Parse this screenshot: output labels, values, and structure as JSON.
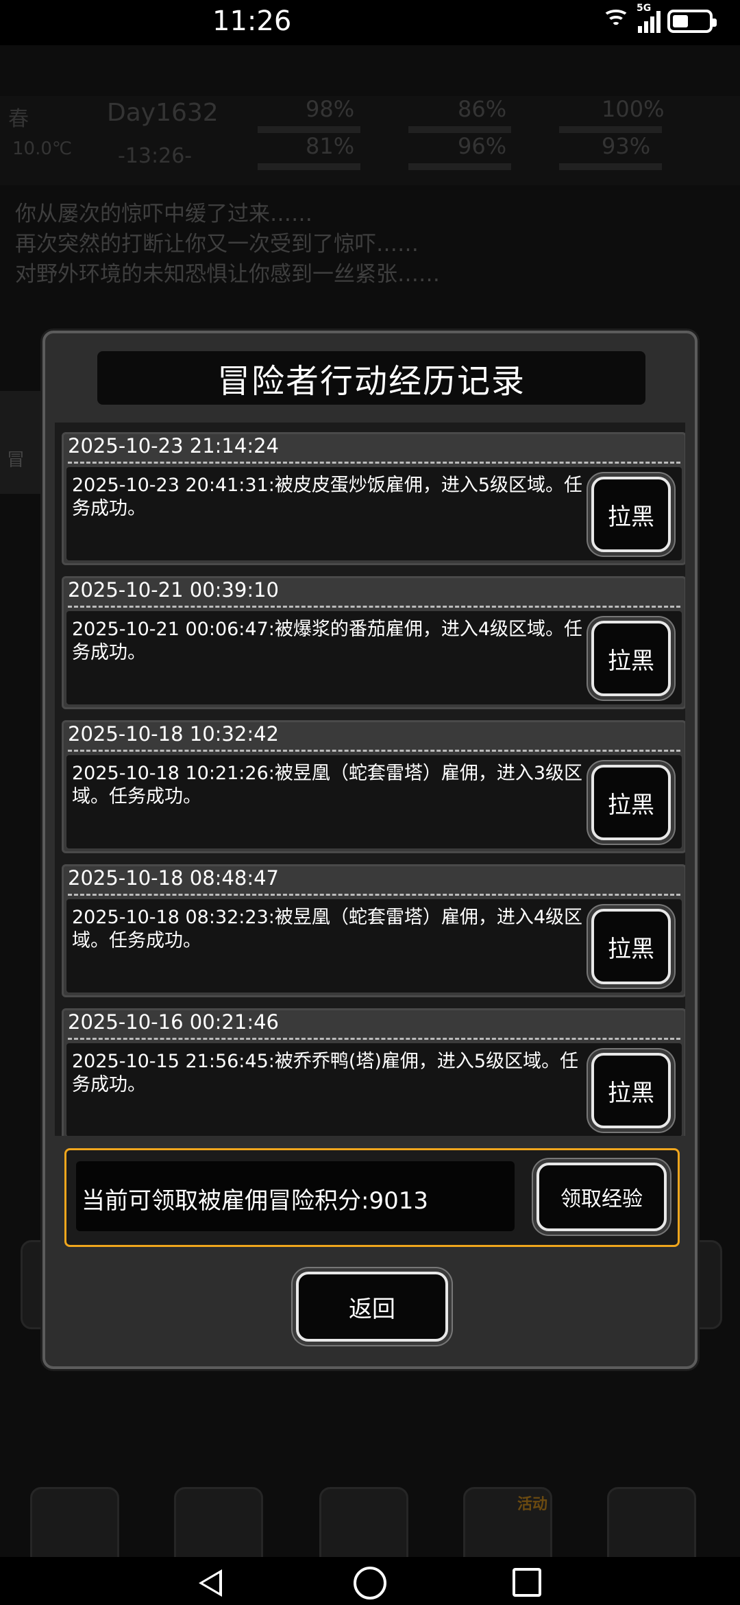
{
  "status_bar": {
    "time": "11:26",
    "network": "5G"
  },
  "background": {
    "season": "春",
    "temperature": "10.0℃",
    "day": "Day1632",
    "clock": "-13:26-",
    "stats": [
      "98%",
      "86%",
      "100%",
      "81%",
      "96%",
      "93%"
    ],
    "log_lines": [
      "你从屡次的惊吓中缓了过来……",
      "再次突然的打断让你又一次受到了惊吓……",
      "对野外环境的未知恐惧让你感到一丝紧张……"
    ],
    "side_label": "冒",
    "shop_badge": "活动"
  },
  "modal": {
    "title": "冒险者行动经历记录",
    "entries": [
      {
        "stamp": "2025-10-23 21:14:24",
        "text": "2025-10-23 20:41:31:被皮皮蛋炒饭雇佣，进入5级区域。任务成功。",
        "action": "拉黑"
      },
      {
        "stamp": "2025-10-21 00:39:10",
        "text": "2025-10-21 00:06:47:被爆浆的番茄雇佣，进入4级区域。任务成功。",
        "action": "拉黑"
      },
      {
        "stamp": "2025-10-18 10:32:42",
        "text": "2025-10-18 10:21:26:被昱凰（蛇套雷塔）雇佣，进入3级区域。任务成功。",
        "action": "拉黑"
      },
      {
        "stamp": "2025-10-18 08:48:47",
        "text": "2025-10-18 08:32:23:被昱凰（蛇套雷塔）雇佣，进入4级区域。任务成功。",
        "action": "拉黑"
      },
      {
        "stamp": "2025-10-16 00:21:46",
        "text": "2025-10-15 21:56:45:被乔乔鸭(塔)雇佣，进入5级区域。任务成功。",
        "action": "拉黑"
      }
    ],
    "claim_text": "当前可领取被雇佣冒险积分:9013",
    "claim_button": "领取经验",
    "back_button": "返回"
  }
}
